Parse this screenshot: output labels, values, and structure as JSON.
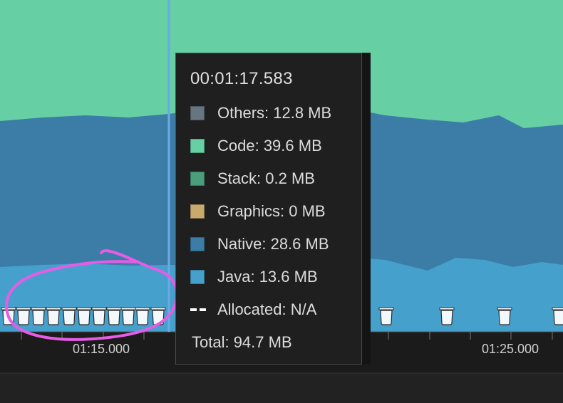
{
  "timeline": {
    "tick_labels": [
      "01:15.000",
      "01:25.000"
    ]
  },
  "colors": {
    "others": "#66757f",
    "code": "#66cfa3",
    "stack": "#4a9e7c",
    "graphics": "#c9a96e",
    "native": "#3b7da6",
    "java": "#46a0cc",
    "cursor": "#6aa9e6",
    "annotation": "#e65ce6",
    "gc": "#eef4f8"
  },
  "tooltip": {
    "time": "00:01:17.583",
    "rows": [
      {
        "label": "Others: 12.8 MB",
        "color": "#66757f"
      },
      {
        "label": "Code: 39.6 MB",
        "color": "#66cfa3"
      },
      {
        "label": "Stack: 0.2 MB",
        "color": "#4a9e7c"
      },
      {
        "label": "Graphics: 0 MB",
        "color": "#c9a96e"
      },
      {
        "label": "Native: 28.6 MB",
        "color": "#3b7da6"
      },
      {
        "label": "Java: 13.6 MB",
        "color": "#46a0cc"
      }
    ],
    "allocated": "Allocated: N/A",
    "total": "Total: 94.7 MB"
  }
}
